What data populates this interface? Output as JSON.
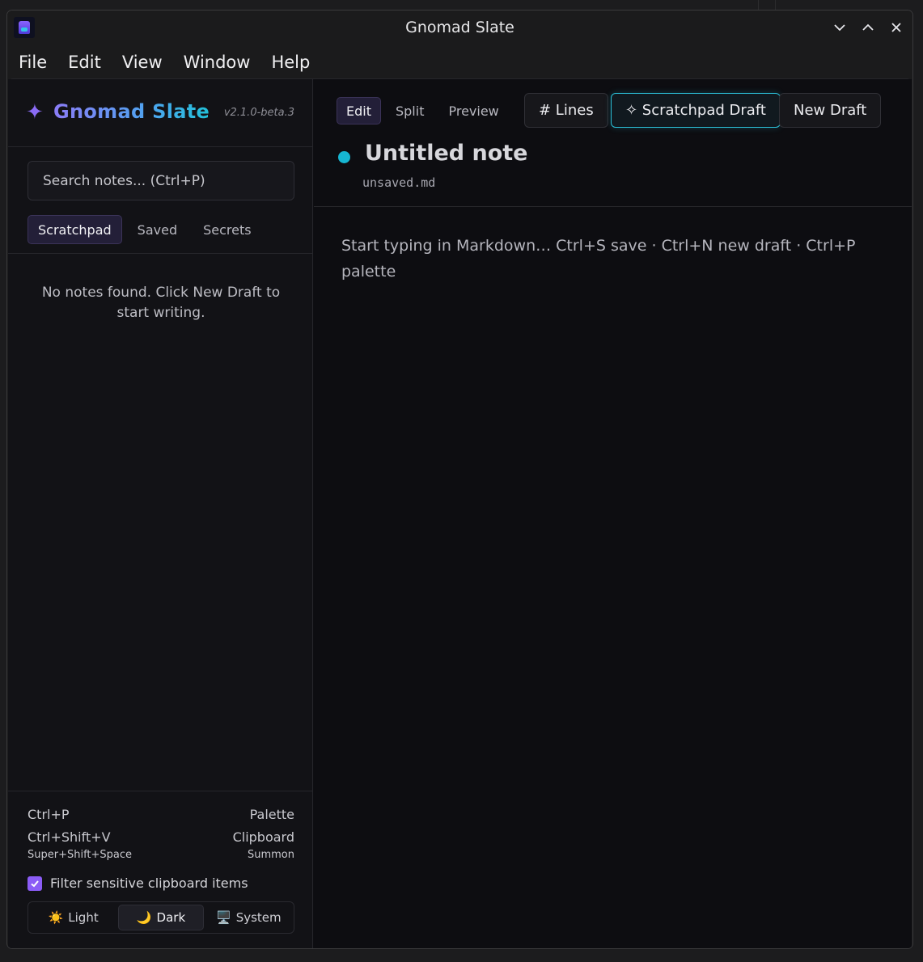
{
  "window": {
    "title": "Gnomad Slate",
    "icons": [
      "app-icon",
      "minimize-icon",
      "maximize-icon",
      "close-icon"
    ]
  },
  "menu": {
    "items": [
      "File",
      "Edit",
      "View",
      "Window",
      "Help"
    ]
  },
  "sidebar": {
    "brand_icon": "sparkle-icon",
    "brand_name": "Gnomad Slate",
    "version": "v2.1.0-beta.3",
    "search_placeholder": "Search notes... (Ctrl+P)",
    "tabs": [
      {
        "label": "Scratchpad",
        "active": true
      },
      {
        "label": "Saved",
        "active": false
      },
      {
        "label": "Secrets",
        "active": false
      }
    ],
    "empty_message": "No notes found. Click New Draft to start writing.",
    "shortcuts": [
      {
        "keys": "Ctrl+P",
        "action": "Palette"
      },
      {
        "keys": "Ctrl+Shift+V",
        "action": "Clipboard"
      },
      {
        "keys": "Super+Shift+Space",
        "action": "Summon"
      }
    ],
    "filter": {
      "label": "Filter sensitive clipboard items",
      "checked": true
    },
    "theme": {
      "options": [
        {
          "icon": "☀️",
          "label": "Light"
        },
        {
          "icon": "🌙",
          "label": "Dark"
        },
        {
          "icon": "🖥️",
          "label": "System"
        }
      ],
      "selected": "Dark"
    }
  },
  "main": {
    "modes": [
      {
        "label": "Edit",
        "active": true
      },
      {
        "label": "Split",
        "active": false
      },
      {
        "label": "Preview",
        "active": false
      }
    ],
    "buttons": {
      "lines": "# Lines",
      "scratchpad_draft": "✧ Scratchpad Draft",
      "new_draft": "New Draft"
    },
    "note": {
      "title": "Untitled note",
      "filename": "unsaved.md",
      "status_color": "#16b6d2"
    },
    "editor_placeholder": "Start typing in Markdown… Ctrl+S save · Ctrl+N new draft · Ctrl+P palette"
  },
  "colors": {
    "accent_purple": "#8b5cf6",
    "accent_cyan": "#2bbfd7",
    "background": "#0e0e12"
  }
}
